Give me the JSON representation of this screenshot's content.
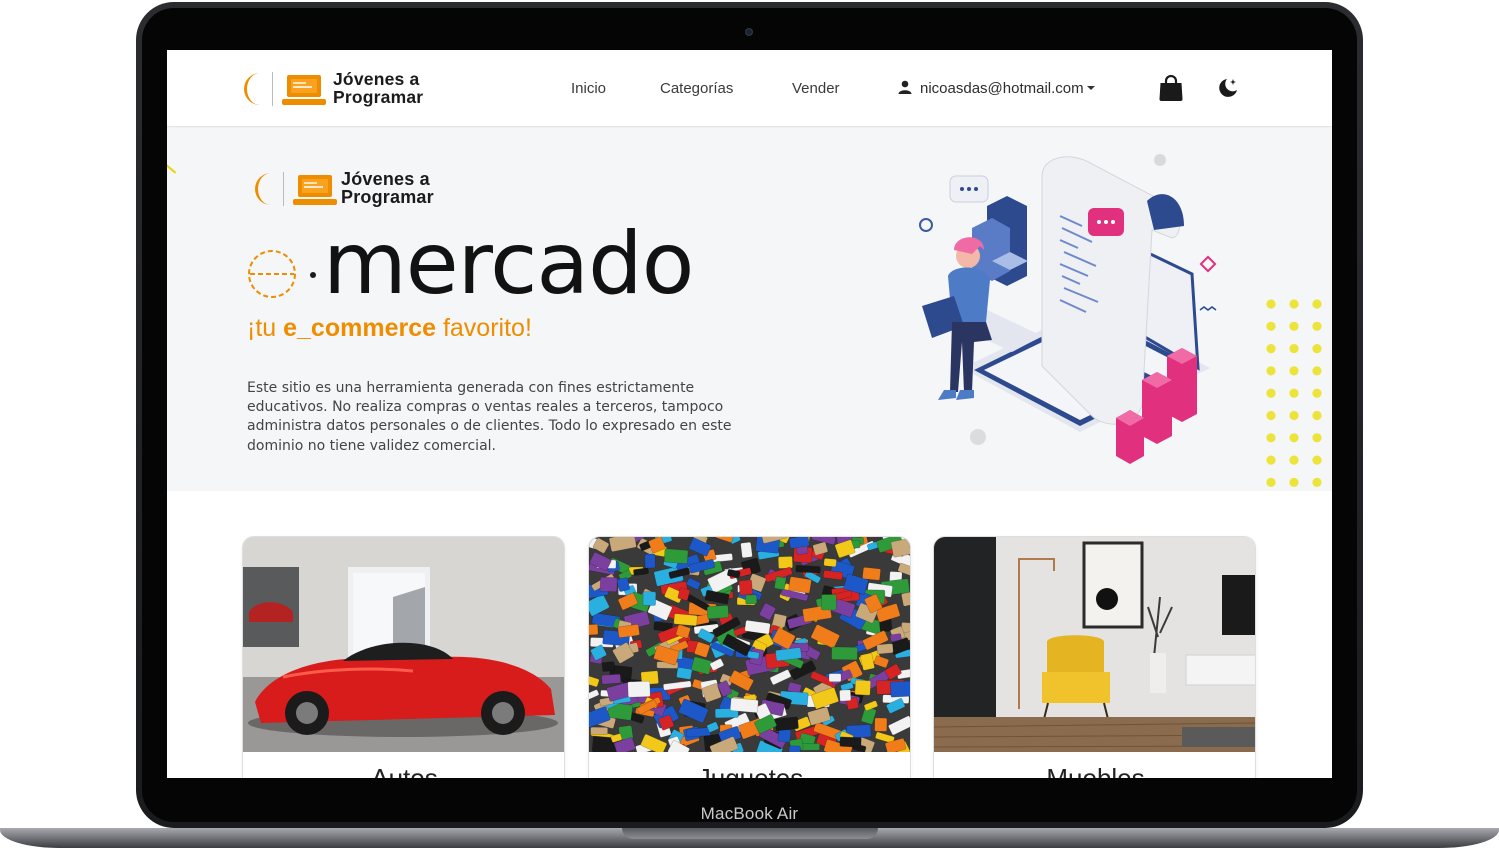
{
  "device": {
    "label": "MacBook Air"
  },
  "navbar": {
    "brand": "Jóvenes a\nProgramar",
    "links": [
      {
        "label": "Inicio"
      },
      {
        "label": "Categorías"
      },
      {
        "label": "Vender"
      }
    ],
    "user_email": "nicoasdas@hotmail.com",
    "cart_icon": "shopping-bag-icon",
    "theme_icon": "moon-icon"
  },
  "hero": {
    "brand": "Jóvenes a\nProgramar",
    "title": "mercado",
    "tagline_pre": "¡tu ",
    "tagline_bold": "e_commerce",
    "tagline_post": " favorito!",
    "disclaimer": "Este sitio es una herramienta generada con fines estrictamente educativos. No realiza compras o ventas reales a terceros, tampoco administra datos personales o de clientes. Todo lo expresado en este dominio no tiene validez comercial."
  },
  "categories": [
    {
      "label": "Autos"
    },
    {
      "label": "Juguetes"
    },
    {
      "label": "Muebles"
    }
  ],
  "colors": {
    "accent": "#ef8d00",
    "dark": "#121212",
    "pink": "#e0307e",
    "navy": "#2e4a8f",
    "yellow_dots": "#ece33b"
  }
}
